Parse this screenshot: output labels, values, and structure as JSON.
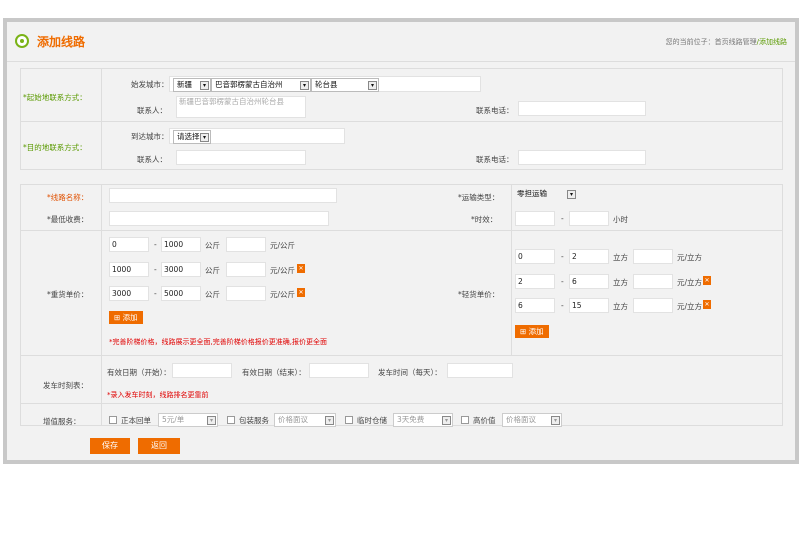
{
  "header": {
    "title": "添加线路",
    "breadcrumb_prefix": "您的当前位子：",
    "breadcrumb_path": "首页线路管理",
    "breadcrumb_current": "/添加线路"
  },
  "origin": {
    "section_label": "*起始地联系方式：",
    "city_label": "始发城市：",
    "province": "新疆",
    "prefecture": "巴音郭楞蒙古自治州",
    "county": "轮台县",
    "contact_label": "联系人：",
    "contact_value": "新疆巴音郭楞蒙古自治州轮台县",
    "phone_label": "联系电话："
  },
  "dest": {
    "section_label": "*目的地联系方式：",
    "city_label": "到达城市：",
    "city_select": "请选择",
    "contact_label": "联系人：",
    "phone_label": "联系电话："
  },
  "form": {
    "route_name_label": "*线路名称：",
    "min_fee_label": "*最低收费：",
    "transport_type_label": "*运输类型：",
    "transport_type_value": "零担运输",
    "time_label": "*时效：",
    "time_unit": "小时",
    "heavy_label": "*重货单价：",
    "light_label": "*轻货单价：",
    "heavy_rows": [
      {
        "from": "0",
        "to": "1000",
        "unit": "公斤",
        "price_unit": "元/公斤"
      },
      {
        "from": "1000",
        "to": "3000",
        "unit": "公斤",
        "price_unit": "元/公斤"
      },
      {
        "from": "3000",
        "to": "5000",
        "unit": "公斤",
        "price_unit": "元/公斤"
      }
    ],
    "light_rows": [
      {
        "from": "0",
        "to": "2",
        "unit": "立方",
        "price_unit": "元/立方"
      },
      {
        "from": "2",
        "to": "6",
        "unit": "立方",
        "price_unit": "元/立方"
      },
      {
        "from": "6",
        "to": "15",
        "unit": "立方",
        "price_unit": "元/立方"
      }
    ],
    "dash": "-",
    "add_label": "添加",
    "heavy_note": "*完善阶梯价格，线路展示更全面,完善阶梯价格报价更准确,报价更全面",
    "schedule_label": "发车时刻表：",
    "valid_start_label": "有效日期（开始）：",
    "valid_end_label": "有效日期（结束）：",
    "depart_time_label": "发车时间（每天）：",
    "schedule_note": "*录入发车时刻，线路排名更靠前",
    "addon_label": "增值服务：",
    "addons": [
      {
        "label": "正本回单",
        "select": "5元/单"
      },
      {
        "label": "包装服务",
        "select": "价格面议"
      },
      {
        "label": "临时仓储",
        "select": "3天免费"
      },
      {
        "label": "高价值",
        "select": "价格面议"
      }
    ]
  },
  "buttons": {
    "save": "保存",
    "back": "返回"
  }
}
